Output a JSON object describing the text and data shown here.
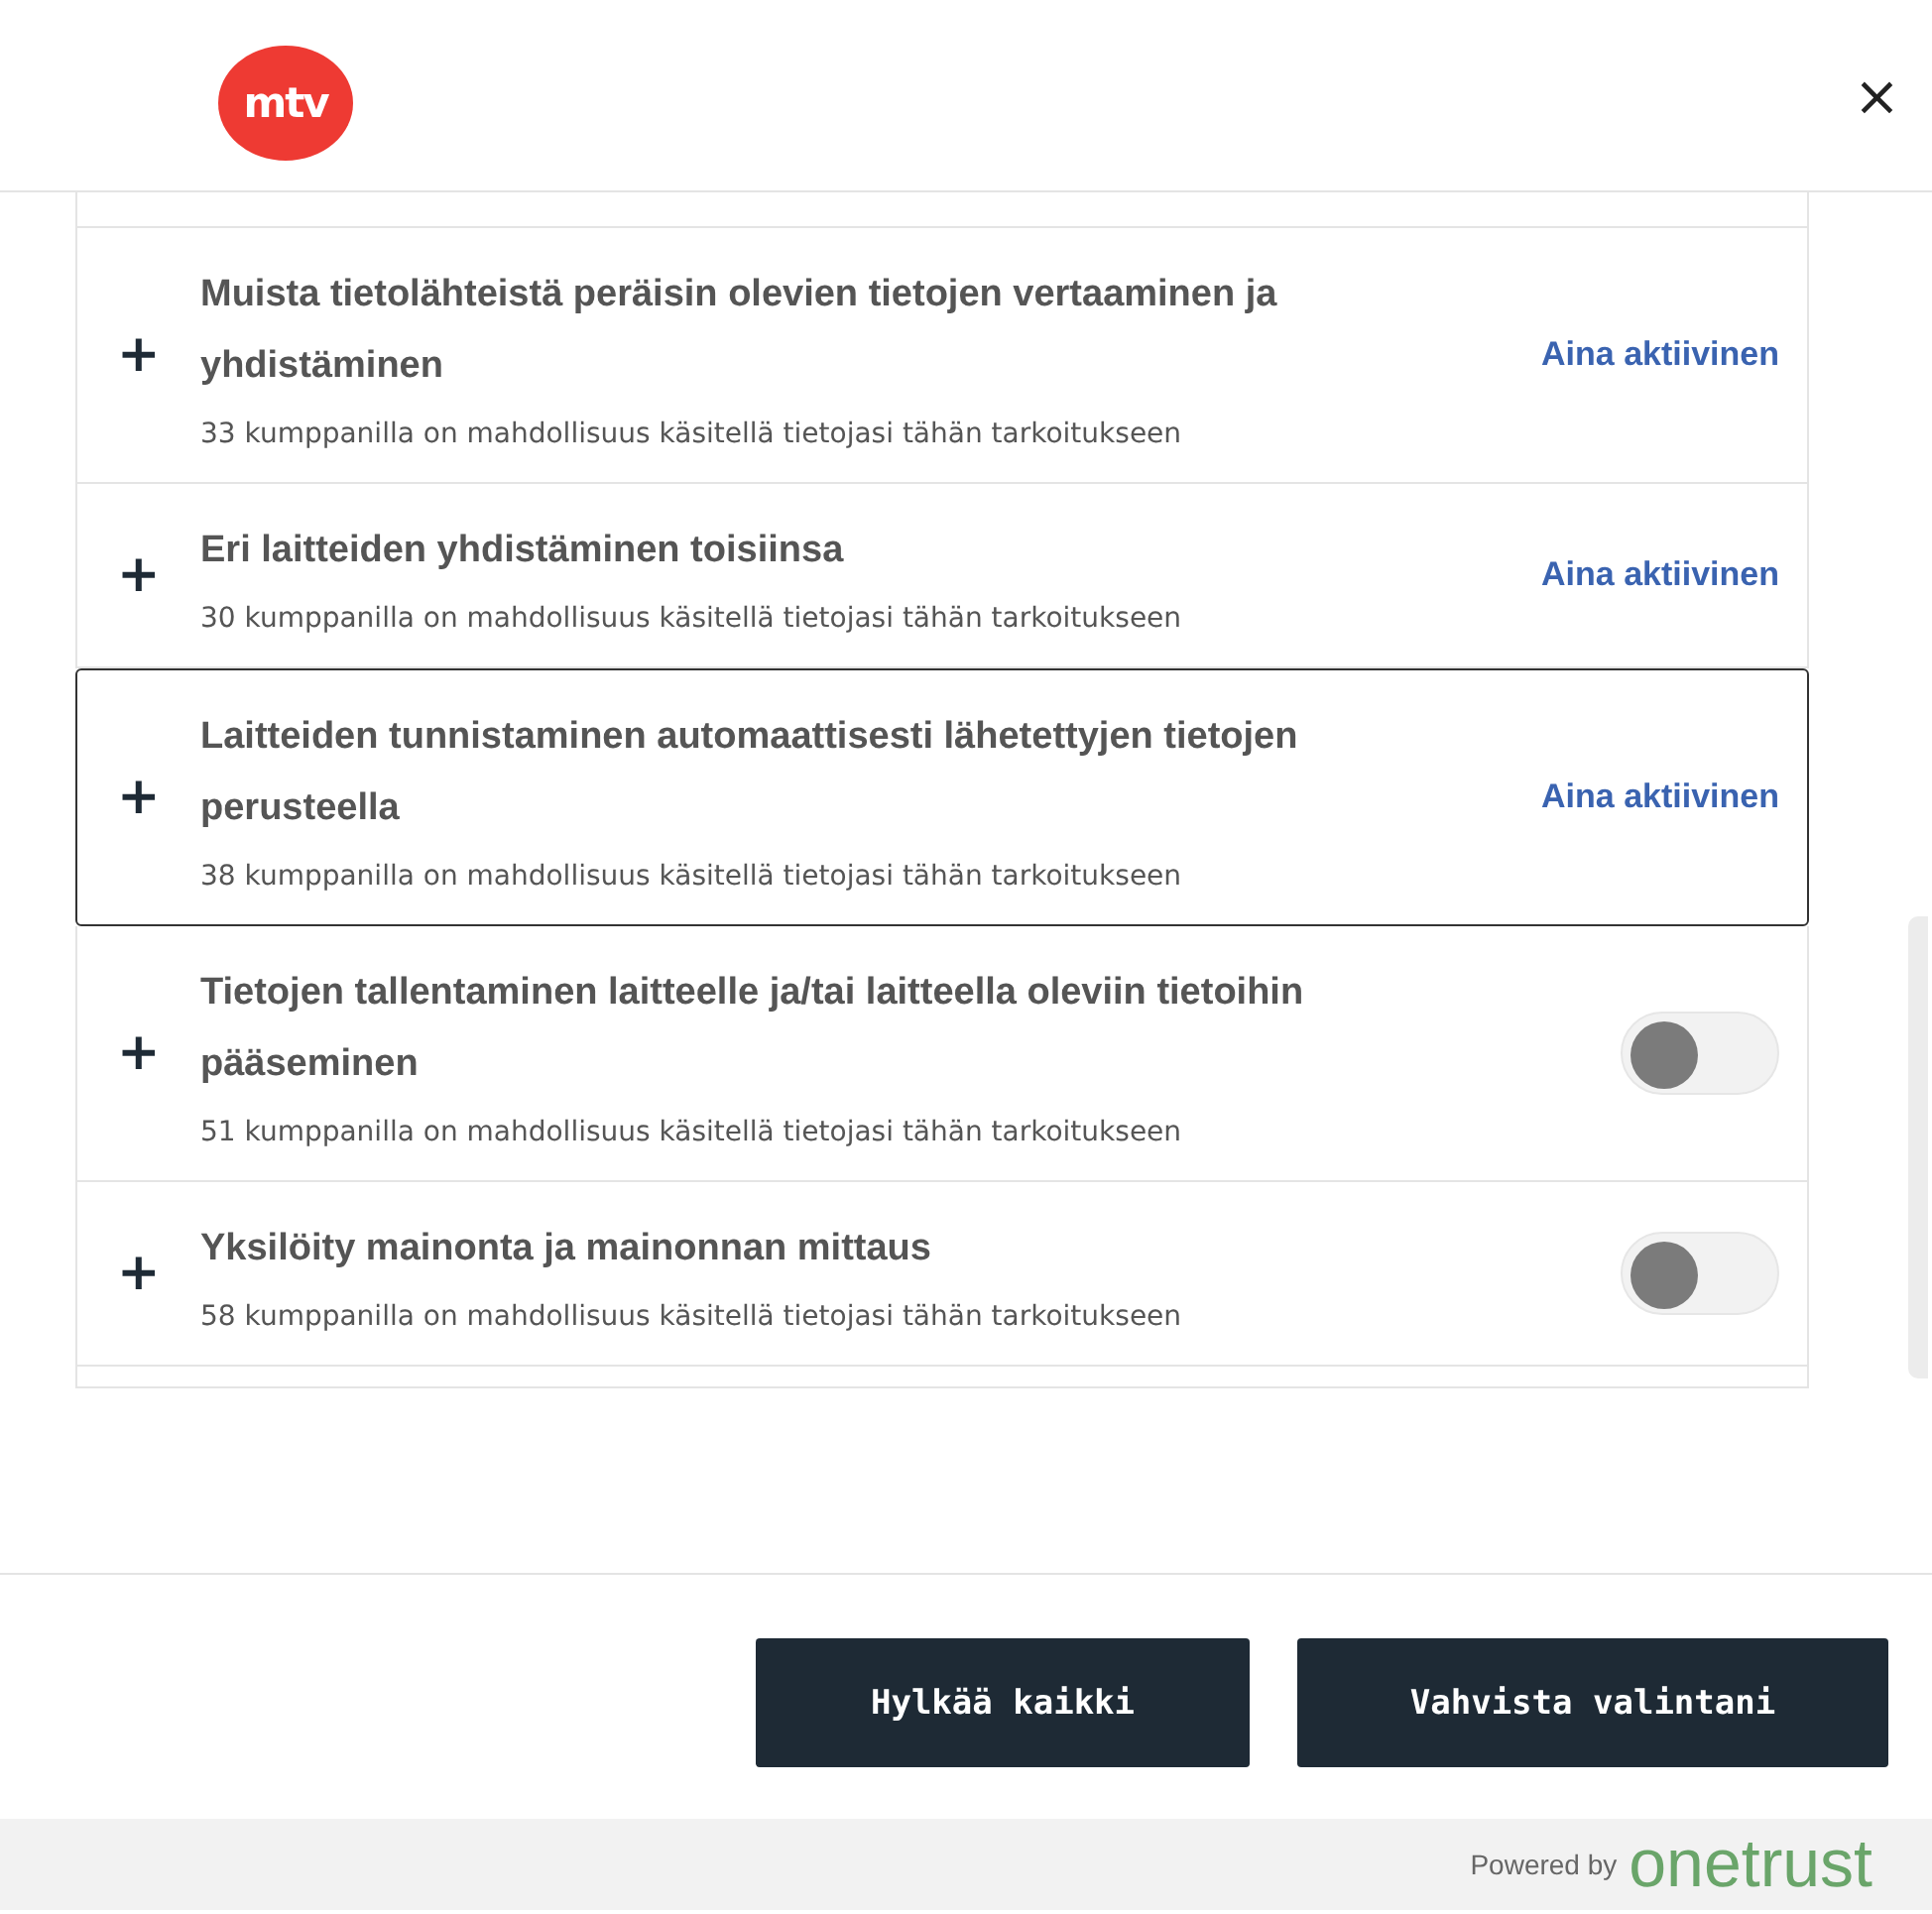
{
  "header": {
    "logo": "mtv",
    "close": "×"
  },
  "purposes": [
    {
      "title": "Muista tietolähteistä peräisin olevien tietojen vertaaminen ja yhdistäminen",
      "description": "33 kumppanilla on mahdollisuus käsitellä tietojasi tähän tarkoitukseen",
      "kind": "always_active",
      "status": "Aina aktiivinen",
      "focused": false,
      "expand": "+"
    },
    {
      "title": "Eri laitteiden yhdistäminen toisiinsa",
      "description": "30 kumppanilla on mahdollisuus käsitellä tietojasi tähän tarkoitukseen",
      "kind": "always_active",
      "status": "Aina aktiivinen",
      "focused": false,
      "expand": "+"
    },
    {
      "title": "Laitteiden tunnistaminen automaattisesti lähetettyjen tietojen perusteella",
      "description": "38 kumppanilla on mahdollisuus käsitellä tietojasi tähän tarkoitukseen",
      "kind": "always_active",
      "status": "Aina aktiivinen",
      "focused": true,
      "expand": "+"
    },
    {
      "title": "Tietojen tallentaminen laitteelle ja/tai laitteella oleviin tietoihin pääseminen",
      "description": "51 kumppanilla on mahdollisuus käsitellä tietojasi tähän tarkoitukseen",
      "kind": "toggle",
      "on": false,
      "focused": false,
      "expand": "+"
    },
    {
      "title": "Yksilöity mainonta ja mainonnan mittaus",
      "description": "58 kumppanilla on mahdollisuus käsitellä tietojasi tähän tarkoitukseen",
      "kind": "toggle",
      "on": false,
      "focused": false,
      "expand": "+"
    }
  ],
  "buttons": [
    "Hylkää kaikki",
    "Vahvista valintani"
  ],
  "footer": {
    "powered_by": "Powered by",
    "brand": "onetrust"
  }
}
